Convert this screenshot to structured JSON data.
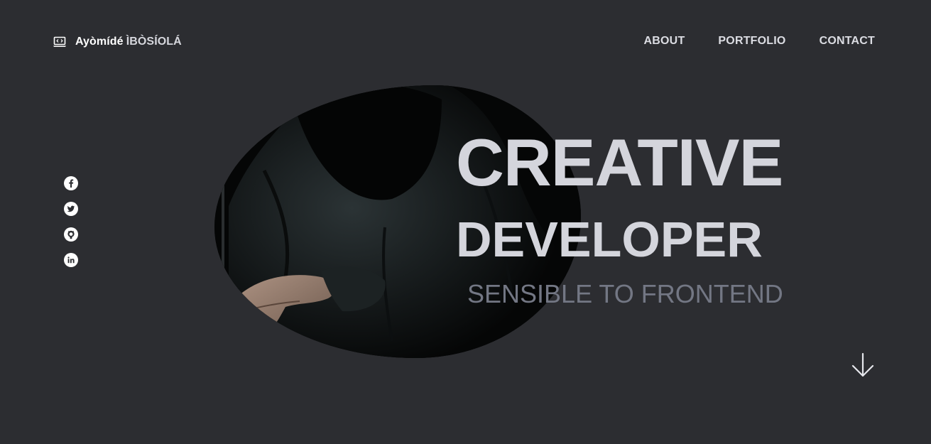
{
  "brand": {
    "first_name": "Ayòmídé",
    "surname": "ÌBÒSÍOLÁ",
    "icon": "laptop-code-icon"
  },
  "nav": {
    "items": [
      "ABOUT",
      "PORTFOLIO",
      "CONTACT"
    ]
  },
  "social": {
    "icons": [
      "facebook-icon",
      "twitter-icon",
      "github-icon",
      "linkedin-icon"
    ]
  },
  "hero": {
    "title_line1": "CREATIVE",
    "title_line2": "DEVELOPER",
    "subtitle": "SENSIBLE TO FRONTEND",
    "image": "hooded-figure-typing-photo"
  },
  "scroll": {
    "icon": "arrow-down-icon"
  },
  "colors": {
    "background": "#2c2d31",
    "title": "#d4d5dc",
    "subtitle": "#737784",
    "nav": "#dcdde3"
  }
}
